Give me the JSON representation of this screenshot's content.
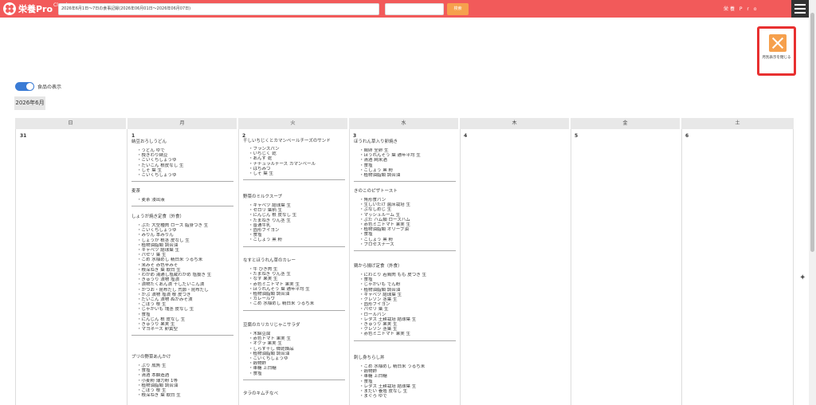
{
  "header": {
    "logo_text": "栄養Pro",
    "logo_cloud": "Cloud",
    "search_value": "2026年6月1日〜7日の食事記録(2026年06月01日〜2026年06月07日)",
    "search_button": "検索",
    "brand_right": "栄養 P r o"
  },
  "monthly_toggle": {
    "label": "月別表示を閉じる"
  },
  "toggle": {
    "label": "食品の表示"
  },
  "month_title": "2026年6月",
  "weekdays": [
    "日",
    "月",
    "火",
    "水",
    "木",
    "金",
    "土"
  ],
  "days": [
    {
      "num": "31",
      "meals": []
    },
    {
      "num": "1",
      "meals": [
        {
          "title": "納豆おろしうどん",
          "foods": [
            "うどん ゆで",
            "挽きわり納豆",
            "こいくちしょうゆ",
            "だいこん 根皮なし 生",
            "しそ 葉 生",
            "こいくちしょうゆ"
          ]
        },
        {
          "title": "麦茶",
          "foods": [
            "麦茶 浸出液"
          ]
        },
        {
          "title": "しょうが焼き定食（外食）",
          "foods": [
            "ぶた 大型種肉 ロース 脂身つき 生",
            "こいくちしょうゆ",
            "みりん 本みりん",
            "しょうが 根茎 皮なし 生",
            "植物油脂類 調合油",
            "キャベツ 結球葉 生",
            "パセリ 葉 生",
            "こめ 水稲めし 精白米 うるち米",
            "米みそ 赤色辛みそ",
            "根深ねぎ 葉 軟白 生",
            "わかめ 湯通し塩蔵わかめ 塩抜き 生",
            "きゅうり 漬物 塩漬",
            "漬物たくあん漬 干しだいこん漬",
            "かつお・昆布だし 荒節・昆布だし",
            "かぶ 漬物 塩漬 根 皮つき",
            "だいこん 漬物 ぬかみそ漬",
            "ごぼう 根 生",
            "じゃがいも 塊茎 皮なし 生",
            "食塩",
            "にんじん 根 皮なし 生",
            "きゅうり 果実 生",
            "マヨネーズ 卵黄型"
          ]
        },
        {
          "title": "ブリの野菜あんかけ",
          "foods": [
            "ぶり 成魚 生",
            "食塩",
            "清酒 本醸造酒",
            "小麦粉 薄力粉 1等",
            "植物油脂類 調合油",
            "ごぼう 根 生",
            "根深ねぎ 葉 軟白 生"
          ]
        }
      ]
    },
    {
      "num": "2",
      "meals": [
        {
          "title": "干しいちじくとカマンベールチーズのサンド",
          "foods": [
            "フランスパン",
            "いちじく 乾",
            "あんず 乾",
            "ナチュラルチーズ カマンベール",
            "はちみつ",
            "しそ 葉 生"
          ]
        },
        {
          "title": "野菜のミルクスープ",
          "foods": [
            "キャベツ 結球葉 生",
            "セロリ 葉柄 生",
            "にんじん 根 皮なし 生",
            "たまねぎ りん茎 生",
            "普通牛乳",
            "固形ブイヨン",
            "食塩",
            "こしょう 黒 粉"
          ]
        },
        {
          "title": "なすとほうれん草のカレー",
          "foods": [
            "牛 ひき肉 生",
            "たまねぎ りん茎 生",
            "なす 果実 生",
            "赤色ミニトマト 果実 生",
            "ほうれんそう 葉 通年平均 生",
            "植物油脂類 調合油",
            "カレールウ",
            "こめ 水稲めし 精白米 うるち米"
          ]
        },
        {
          "title": "豆腐のカリカリじゃこサラダ",
          "foods": [
            "木綿豆腐",
            "赤色トマト 果実 生",
            "オクラ 果実 生",
            "しらす干し 微乾燥品",
            "植物油脂類 調合油",
            "こいくちしょうゆ",
            "穀物酢",
            "車糖 上白糖",
            "食塩"
          ]
        },
        {
          "title": "タラのキムチなべ",
          "foods": []
        }
      ]
    },
    {
      "num": "3",
      "meals": [
        {
          "title": "ほうれん草入り卵焼き",
          "foods": [
            "鶏卵 全卵 生",
            "ほうれんそう 葉 通年平均 生",
            "清酒 純米酒",
            "食塩",
            "こしょう 黒 粉",
            "植物油脂類 調合油"
          ]
        },
        {
          "title": "きのこのピザトースト",
          "foods": [
            "角形食パン",
            "生しいたけ 菌床栽培 生",
            "ぶなしめじ 生",
            "マッシュルーム 生",
            "ぶた ハム類 ロースハム",
            "赤色ミニトマト 果実 生",
            "植物油脂類 オリーブ油",
            "食塩",
            "こしょう 黒 粉",
            "プロセスチーズ"
          ]
        },
        {
          "title": "鶏から揚げ定食（外食）",
          "foods": [
            "にわとり 若鶏肉 もも 皮つき 生",
            "食塩",
            "じゃがいも でん粉",
            "植物油脂類 調合油",
            "キャベツ 結球葉 生",
            "クレソン 茎葉 生",
            "固形ブイヨン",
            "パセリ 葉 生",
            "ロールパン",
            "レタス 土耕栽培 結球葉 生",
            "きゅうり 果実 生",
            "クレソン 茎葉 生",
            "赤色ミニトマト 果実 生"
          ]
        },
        {
          "title": "刺し身ちらし丼",
          "foods": [
            "こめ 水稲めし 精白米 うるち米",
            "穀物酢",
            "車糖 上白糖",
            "食塩",
            "レタス 土耕栽培 結球葉 生",
            "まだい 養殖 皮なし 生",
            "まぐろ ゆで"
          ]
        }
      ]
    },
    {
      "num": "4",
      "meals": []
    },
    {
      "num": "5",
      "meals": []
    },
    {
      "num": "6",
      "meals": []
    }
  ]
}
